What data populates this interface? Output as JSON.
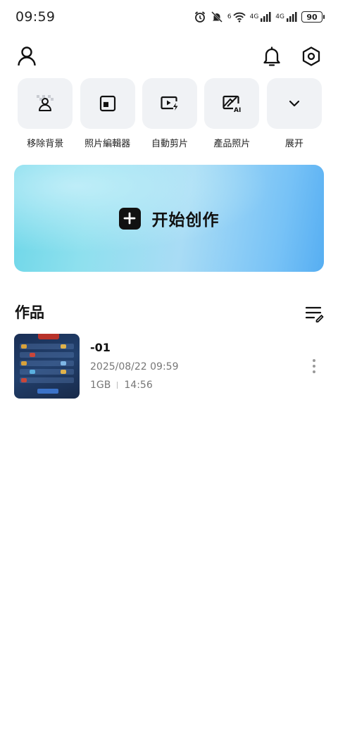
{
  "status_bar": {
    "time": "09:59",
    "network_labels": [
      "6",
      "4G",
      "4G"
    ],
    "battery": "90"
  },
  "top_bar": {
    "icons": [
      "profile-icon",
      "bell-icon",
      "settings-icon"
    ]
  },
  "tools": [
    {
      "label": "移除背景",
      "icon": "remove-background-icon"
    },
    {
      "label": "照片編輯器",
      "icon": "photo-editor-icon"
    },
    {
      "label": "自動剪片",
      "icon": "auto-cut-icon"
    },
    {
      "label": "產品照片",
      "icon": "product-photo-ai-icon"
    },
    {
      "label": "展开",
      "icon": "chevron-down-icon"
    }
  ],
  "create": {
    "label": "开始创作",
    "icon": "plus-icon"
  },
  "works": {
    "title": "作品",
    "sort_icon": "sort-edit-icon",
    "items": [
      {
        "title": "-01",
        "date": "2025/08/22 09:59",
        "size": "1GB",
        "duration": "14:56"
      }
    ]
  },
  "colors": {
    "banner_start": "#6cd6e8",
    "banner_end": "#56aef2",
    "tile_bg": "#f0f2f5"
  }
}
